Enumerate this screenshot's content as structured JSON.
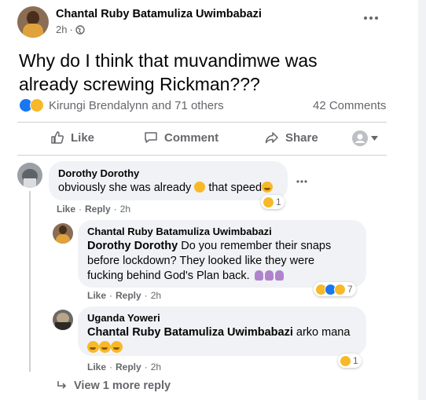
{
  "post": {
    "author": "Chantal Ruby Batamuliza Uwimbabazi",
    "time": "2h",
    "separator": "·",
    "text_line1": "Why do I think that muvandimwe was",
    "text_line2": "already screwing Rickman???",
    "reactors": "Kirungi Brendalynn and 71 others",
    "comments_count": "42 Comments"
  },
  "actions": {
    "like": "Like",
    "comment": "Comment",
    "share": "Share"
  },
  "comments": [
    {
      "author": "Dorothy Dorothy",
      "text": "obviously she was already",
      "text2": "that speed",
      "like": "Like",
      "reply": "Reply",
      "time": "2h",
      "reaction_count": "1"
    },
    {
      "author": "Chantal Ruby Batamuliza Uwimbabazi",
      "mention": "Dorothy Dorothy",
      "text_line1": "Do you remember their snaps",
      "text_line2": "before lockdown? They looked like they were",
      "text_line3": "fucking behind God's Plan back.",
      "like": "Like",
      "reply": "Reply",
      "time": "2h",
      "reaction_count": "7"
    },
    {
      "author": "Uganda Yoweri",
      "mention": "Chantal Ruby Batamuliza Uwimbabazi",
      "text": "arko mana",
      "like": "Like",
      "reply": "Reply",
      "time": "2h",
      "reaction_count": "1"
    }
  ],
  "more_replies": "View 1 more reply",
  "colors": {
    "like_blue": "#1877f2",
    "haha_yellow": "#f7b928",
    "meta_gray": "#65676b",
    "bubble_bg": "#f0f2f5"
  },
  "icons": [
    "globe-icon",
    "more-icon",
    "like-icon",
    "comment-icon",
    "share-icon",
    "profile-icon",
    "caret-down-icon",
    "reply-arrow-icon"
  ]
}
